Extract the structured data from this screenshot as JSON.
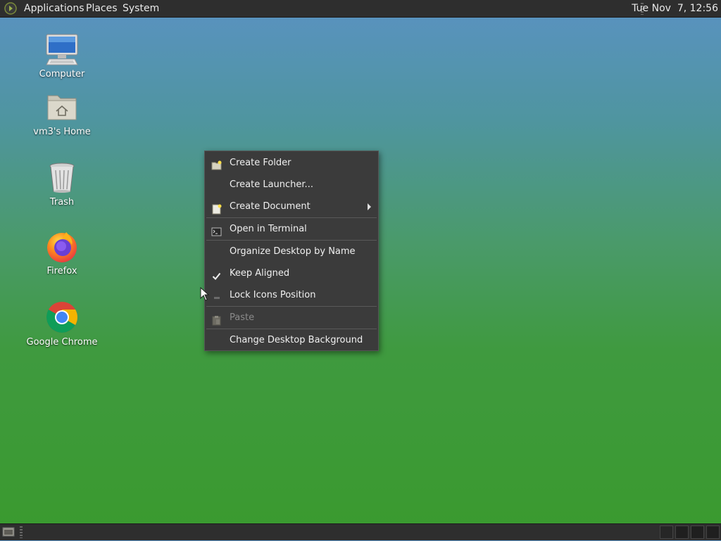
{
  "top_panel": {
    "menus": [
      "Applications",
      "Places",
      "System"
    ],
    "clock": "Tue Nov  7, 12:56"
  },
  "desktop_icons": [
    {
      "label": "Computer",
      "icon": "computer-icon"
    },
    {
      "label": "vm3's Home",
      "icon": "home-folder-icon"
    },
    {
      "label": "Trash",
      "icon": "trash-icon"
    },
    {
      "label": "Firefox",
      "icon": "firefox-icon"
    },
    {
      "label": "Google Chrome",
      "icon": "chrome-icon"
    }
  ],
  "context_menu": {
    "items": [
      {
        "label": "Create Folder",
        "icon": "folder-new-icon"
      },
      {
        "label": "Create Launcher...",
        "icon": ""
      },
      {
        "label": "Create Document",
        "icon": "document-new-icon",
        "submenu": true
      },
      {
        "label": "Open in Terminal",
        "icon": "terminal-icon"
      },
      {
        "label": "Organize Desktop by Name",
        "icon": ""
      },
      {
        "label": "Keep Aligned",
        "icon": "checkmark-icon",
        "checked": true
      },
      {
        "label": "Lock Icons Position",
        "icon": "unchecked-dash-icon",
        "checked": false
      },
      {
        "label": "Paste",
        "icon": "paste-icon",
        "disabled": true
      },
      {
        "label": "Change Desktop Background",
        "icon": ""
      }
    ]
  },
  "colors": {
    "panel": "#2e2e2e",
    "menu_bg": "#3b3b3b",
    "menu_text": "#f0f0f0",
    "disabled_text": "#8a8a8a"
  }
}
